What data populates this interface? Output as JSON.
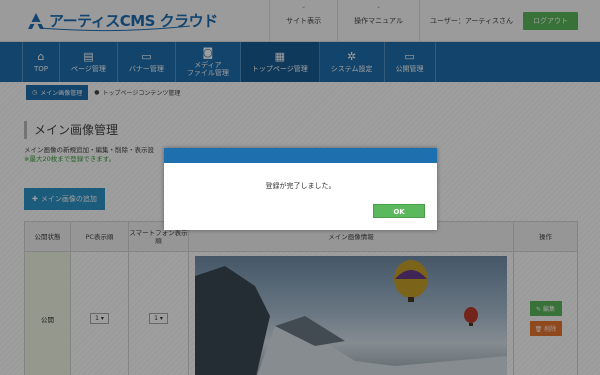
{
  "app": {
    "logo_text": "アーティスCMS クラウド"
  },
  "header": {
    "links": [
      {
        "label": "サイト表示"
      },
      {
        "label": "操作マニュアル"
      }
    ],
    "user_text": "ユーザー：アーティスさん",
    "logout_label": "ログアウト"
  },
  "nav": {
    "items": [
      {
        "label": "TOP",
        "icon": "home-icon",
        "glyph": "⌂"
      },
      {
        "label": "ページ管理",
        "icon": "document-icon",
        "glyph": "▤"
      },
      {
        "label": "バナー管理",
        "icon": "banner-icon",
        "glyph": "▭"
      },
      {
        "label": "メディア\nファイル管理",
        "icon": "camera-icon",
        "glyph": "◙"
      },
      {
        "label": "トップページ管理",
        "icon": "calculator-icon",
        "glyph": "▦"
      },
      {
        "label": "システム設定",
        "icon": "gears-icon",
        "glyph": "✲"
      },
      {
        "label": "公開管理",
        "icon": "monitor-icon",
        "glyph": "▭"
      }
    ],
    "active_index": 4
  },
  "breadcrumb": {
    "first": "メイン画像管理",
    "second": "トップページコンテンツ管理"
  },
  "page": {
    "title": "メイン画像管理",
    "description": "メイン画像の新規追加・編集・削除・表示設",
    "note": "※最大20枚まで登録できます。",
    "add_button": "メイン画像の追加"
  },
  "table": {
    "headers": [
      "公開状態",
      "PC表示順",
      "スマートフォン表示順",
      "メイン画像情報",
      "操作"
    ],
    "rows": [
      {
        "status": "公開",
        "pc_order": "1",
        "sp_order": "1",
        "edit_label": "編集",
        "delete_label": "削除"
      }
    ]
  },
  "modal": {
    "message": "登録が完了しました。",
    "ok_label": "OK"
  },
  "colors": {
    "primary": "#1d6fae",
    "success": "#5cb85c",
    "danger": "#e8772e"
  }
}
